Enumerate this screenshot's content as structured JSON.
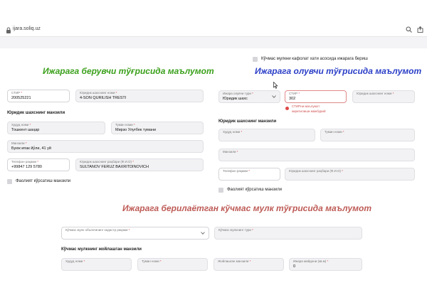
{
  "browser": {
    "url": "ijara.soliq.uz",
    "lock_icon": "lock-icon",
    "zoom_icon": "zoom-icon",
    "share_icon": "share-icon"
  },
  "guarantee": {
    "label": "Кўчмас мулкни кафолат хати асосида ижарага бериш"
  },
  "lessor": {
    "title": "Ижарага берувчи тўғрисида маълумот",
    "stir_label": "СТИР",
    "stir_value": "200525221",
    "name_label": "Юридик шахснинг номи",
    "name_value": "4-SON QURILISH TRESTI",
    "address_heading": "Юридик шахснинг манзили",
    "region_label": "Худуд номи",
    "region_value": "Тошкент шаҳар",
    "district_label": "Туман номи",
    "district_value": "Мирзо Улуғбек тумани",
    "street_label": "Манзили",
    "street_value": "Буюк ипак йўли, 41 уй",
    "phone_label": "Телефон рақами",
    "phone_value": "+99847 129 5780",
    "head_label": "Юридик шахснинг раҳбари (Ф.И.О)",
    "head_value": "SULTANOV FERUZ BAXRITDINOVICH",
    "activity_label": "Фаолият кўрсатиш манзили"
  },
  "lessee": {
    "title": "Ижарага олувчи тўғрисида маълумот",
    "type_label": "Ижара олувчи тури",
    "type_value": "Юридик шахс",
    "stir_label": "СТИР",
    "stir_value": "302",
    "stir_error": "СТИРни маълумот киритилиши мажбурий",
    "name_label": "Юридик шахснинг номи",
    "address_heading": "Юридик шахснинг манзили",
    "region_label": "Худуд номи",
    "district_label": "Туман номи",
    "street_label": "Манзили",
    "phone_label": "Телефон рақами",
    "head_label": "Юридик шахснинг раҳбари (Ф.И.О)",
    "activity_label": "Фаолият кўрсатиш манзили"
  },
  "property": {
    "title": "Ижарага берилаётган кўчмас мулк тўғрисида маълумот",
    "cadastre_label": "Кўчмас мулк объектининг кадастр рақами",
    "type_label": "Кўчмас мулкнинг тури",
    "address_heading": "Кўчмас мулкнинг жойлашган манзили",
    "region_label": "Худуд номи",
    "district_label": "Туман номи",
    "street_label": "Жойлашган манзили",
    "area_label": "Ижара майдони (кв.м)",
    "area_value": "0"
  },
  "colors": {
    "green": "#3aa01a",
    "blue": "#2b3fc7",
    "red": "#bd5a55",
    "error": "#e04848"
  }
}
